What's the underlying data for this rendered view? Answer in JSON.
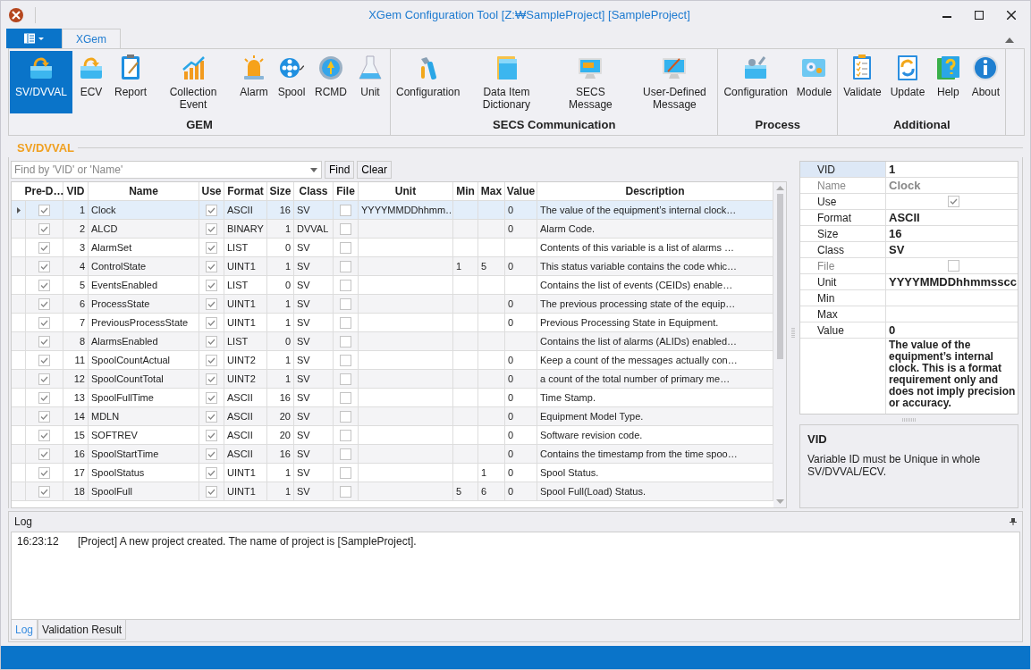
{
  "window": {
    "title": "XGem Configuration Tool [Z:₩SampleProject] [SampleProject]"
  },
  "ribbon_tabs": [
    {
      "label": "XGem",
      "selected": true
    }
  ],
  "ribbon_groups": [
    {
      "label": "GEM",
      "items": [
        {
          "label": "SV/DVVAL",
          "selected": true
        },
        {
          "label": "ECV",
          "selected": false
        },
        {
          "label": "Report",
          "selected": false
        },
        {
          "label": "Collection Event",
          "selected": false
        },
        {
          "label": "Alarm",
          "selected": false
        },
        {
          "label": "Spool",
          "selected": false
        },
        {
          "label": "RCMD",
          "selected": false
        },
        {
          "label": "Unit",
          "selected": false
        }
      ]
    },
    {
      "label": "SECS Communication",
      "items": [
        {
          "label": "Configuration",
          "selected": false
        },
        {
          "label": "Data Item Dictionary",
          "selected": false
        },
        {
          "label": "SECS Message",
          "selected": false
        },
        {
          "label": "User-Defined Message",
          "selected": false
        }
      ]
    },
    {
      "label": "Process",
      "items": [
        {
          "label": "Configuration",
          "selected": false
        },
        {
          "label": "Module",
          "selected": false
        }
      ]
    },
    {
      "label": "Additional",
      "items": [
        {
          "label": "Validate",
          "selected": false
        },
        {
          "label": "Update",
          "selected": false
        },
        {
          "label": "Help",
          "selected": false
        },
        {
          "label": "About",
          "selected": false
        }
      ]
    }
  ],
  "section_title": "SV/DVVAL",
  "search": {
    "placeholder": "Find by 'VID' or 'Name'",
    "buttons": [
      "Find",
      "Clear"
    ]
  },
  "table": {
    "columns": [
      "Pre-D…",
      "VID",
      "Name",
      "Use",
      "Format",
      "Size",
      "Class",
      "File",
      "Unit",
      "Min",
      "Max",
      "Value",
      "Description"
    ],
    "rows": [
      {
        "selected": true,
        "pre_defined": true,
        "vid": "1",
        "name": "Clock",
        "use": true,
        "format": "ASCII",
        "size": "16",
        "class": "SV",
        "file": false,
        "unit": "YYYYMMDDhhmm…",
        "value": "0",
        "description": "The value of the equipment’s internal clock…"
      },
      {
        "selected": false,
        "pre_defined": true,
        "vid": "2",
        "name": "ALCD",
        "use": true,
        "format": "BINARY",
        "size": "1",
        "class": "DVVAL",
        "file": false,
        "value": "0",
        "description": "Alarm Code."
      },
      {
        "selected": false,
        "pre_defined": true,
        "vid": "3",
        "name": "AlarmSet",
        "use": true,
        "format": "LIST",
        "size": "0",
        "class": "SV",
        "file": false,
        "description": "Contents of this variable is a list of alarms …"
      },
      {
        "selected": false,
        "pre_defined": true,
        "vid": "4",
        "name": "ControlState",
        "use": true,
        "format": "UINT1",
        "size": "1",
        "class": "SV",
        "file": false,
        "min": "1",
        "max": "5",
        "value": "0",
        "description": "This status variable contains the code whic…"
      },
      {
        "selected": false,
        "pre_defined": true,
        "vid": "5",
        "name": "EventsEnabled",
        "use": true,
        "format": "LIST",
        "size": "0",
        "class": "SV",
        "file": false,
        "description": "Contains the list of events (CEIDs) enable…"
      },
      {
        "selected": false,
        "pre_defined": true,
        "vid": "6",
        "name": "ProcessState",
        "use": true,
        "format": "UINT1",
        "size": "1",
        "class": "SV",
        "file": false,
        "value": "0",
        "description": "The previous processing state of the equip…"
      },
      {
        "selected": false,
        "pre_defined": true,
        "vid": "7",
        "name": "PreviousProcessState",
        "use": true,
        "format": "UINT1",
        "size": "1",
        "class": "SV",
        "file": false,
        "value": "0",
        "description": "Previous Processing State in Equipment."
      },
      {
        "selected": false,
        "pre_defined": true,
        "vid": "8",
        "name": "AlarmsEnabled",
        "use": true,
        "format": "LIST",
        "size": "0",
        "class": "SV",
        "file": false,
        "description": "Contains the list of alarms (ALIDs) enabled…"
      },
      {
        "selected": false,
        "pre_defined": true,
        "vid": "11",
        "name": "SpoolCountActual",
        "use": true,
        "format": "UINT2",
        "size": "1",
        "class": "SV",
        "file": false,
        "value": "0",
        "description": "Keep a count of the messages actually con…"
      },
      {
        "selected": false,
        "pre_defined": true,
        "vid": "12",
        "name": "SpoolCountTotal",
        "use": true,
        "format": "UINT2",
        "size": "1",
        "class": "SV",
        "file": false,
        "value": "0",
        "description": "a count of the total number of primary me…"
      },
      {
        "selected": false,
        "pre_defined": true,
        "vid": "13",
        "name": "SpoolFullTime",
        "use": true,
        "format": "ASCII",
        "size": "16",
        "class": "SV",
        "file": false,
        "value": "0",
        "description": "Time Stamp."
      },
      {
        "selected": false,
        "pre_defined": true,
        "vid": "14",
        "name": "MDLN",
        "use": true,
        "format": "ASCII",
        "size": "20",
        "class": "SV",
        "file": false,
        "value": "0",
        "description": "Equipment Model Type."
      },
      {
        "selected": false,
        "pre_defined": true,
        "vid": "15",
        "name": "SOFTREV",
        "use": true,
        "format": "ASCII",
        "size": "20",
        "class": "SV",
        "file": false,
        "value": "0",
        "description": "Software revision code."
      },
      {
        "selected": false,
        "pre_defined": true,
        "vid": "16",
        "name": "SpoolStartTime",
        "use": true,
        "format": "ASCII",
        "size": "16",
        "class": "SV",
        "file": false,
        "value": "0",
        "description": "Contains the timestamp from the time spoo…"
      },
      {
        "selected": false,
        "pre_defined": true,
        "vid": "17",
        "name": "SpoolStatus",
        "use": true,
        "format": "UINT1",
        "size": "1",
        "class": "SV",
        "file": false,
        "max": "1",
        "value": "0",
        "description": "Spool Status."
      },
      {
        "selected": false,
        "pre_defined": true,
        "vid": "18",
        "name": "SpoolFull",
        "use": true,
        "format": "UINT1",
        "size": "1",
        "class": "SV",
        "file": false,
        "min": "5",
        "max": "6",
        "value": "0",
        "description": "Spool Full(Load) Status."
      }
    ]
  },
  "properties": [
    {
      "label": "VID",
      "kind": "text",
      "value": "1",
      "disabled": false,
      "selected": true
    },
    {
      "label": "Name",
      "kind": "text",
      "value": "Clock",
      "disabled": true,
      "selected": false
    },
    {
      "label": "Use",
      "kind": "check",
      "checked": true,
      "disabled": false,
      "selected": false
    },
    {
      "label": "Format",
      "kind": "text",
      "value": "ASCII",
      "disabled": false,
      "selected": false
    },
    {
      "label": "Size",
      "kind": "text",
      "value": "16",
      "disabled": false,
      "selected": false
    },
    {
      "label": "Class",
      "kind": "text",
      "value": "SV",
      "disabled": false,
      "selected": false
    },
    {
      "label": "File",
      "kind": "check",
      "checked": false,
      "disabled": true,
      "selected": false
    },
    {
      "label": "Unit",
      "kind": "text",
      "value": "YYYYMMDDhhmmsscc",
      "disabled": false,
      "selected": false
    },
    {
      "label": "Min",
      "kind": "text",
      "disabled": false,
      "selected": false
    },
    {
      "label": "Max",
      "kind": "text",
      "disabled": false,
      "selected": false
    },
    {
      "label": "Value",
      "kind": "text",
      "value": "0",
      "disabled": false,
      "selected": false
    },
    {
      "kind": "long",
      "value": "The value of the equipment’s internal clock. This is a format requirement only and does not imply precision or accuracy.",
      "selected": false
    }
  ],
  "help": {
    "title": "VID",
    "text": "Variable ID must be Unique in whole SV/DVVAL/ECV."
  },
  "log": {
    "title": "Log",
    "entries": [
      {
        "time": "16:23:12",
        "message": "[Project] A new project created. The name of project is [SampleProject]."
      }
    ]
  },
  "log_tabs": [
    {
      "label": "Log",
      "selected": true
    },
    {
      "label": "Validation Result",
      "selected": false
    }
  ]
}
